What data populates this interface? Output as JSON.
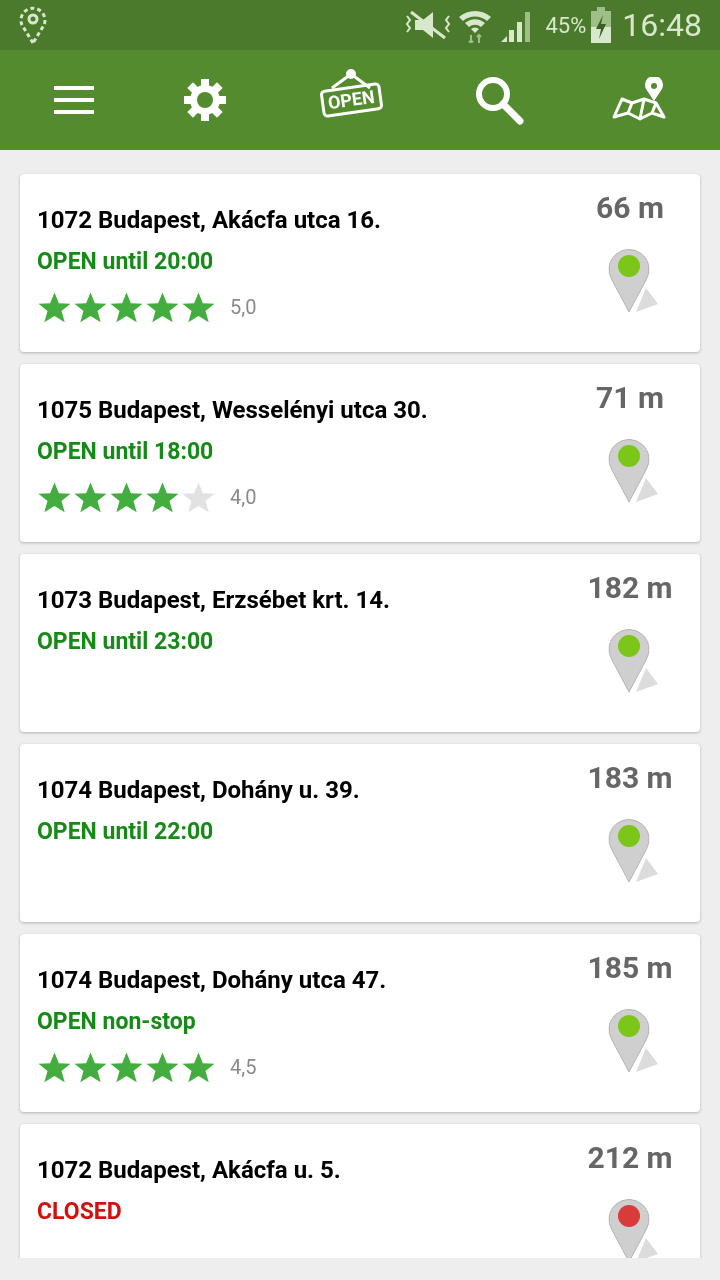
{
  "status_bar": {
    "battery": "45%",
    "time": "16:48"
  },
  "toolbar": {
    "sign_label": "OPEN"
  },
  "places": [
    {
      "address": "1072 Budapest, Akácfa utca 16.",
      "status": "OPEN until 20:00",
      "open": true,
      "stars": 5,
      "rating": "5,0",
      "distance": "66 m",
      "color": "#7cc61a"
    },
    {
      "address": "1075 Budapest, Wesselényi utca 30.",
      "status": "OPEN until 18:00",
      "open": true,
      "stars": 4,
      "rating": "4,0",
      "distance": "71 m",
      "color": "#7cc61a"
    },
    {
      "address": "1073 Budapest, Erzsébet krt. 14.",
      "status": "OPEN until 23:00",
      "open": true,
      "distance": "182 m",
      "color": "#7cc61a"
    },
    {
      "address": "1074 Budapest, Dohány u. 39.",
      "status": "OPEN until 22:00",
      "open": true,
      "distance": "183 m",
      "color": "#7cc61a"
    },
    {
      "address": "1074 Budapest, Dohány utca 47.",
      "status": "OPEN non-stop",
      "open": true,
      "stars": 5,
      "rating": "4,5",
      "distance": "185 m",
      "color": "#7cc61a"
    },
    {
      "address": "1072 Budapest, Akácfa u. 5.",
      "status": "CLOSED",
      "open": false,
      "distance": "212 m",
      "color": "#d93a3a"
    }
  ]
}
